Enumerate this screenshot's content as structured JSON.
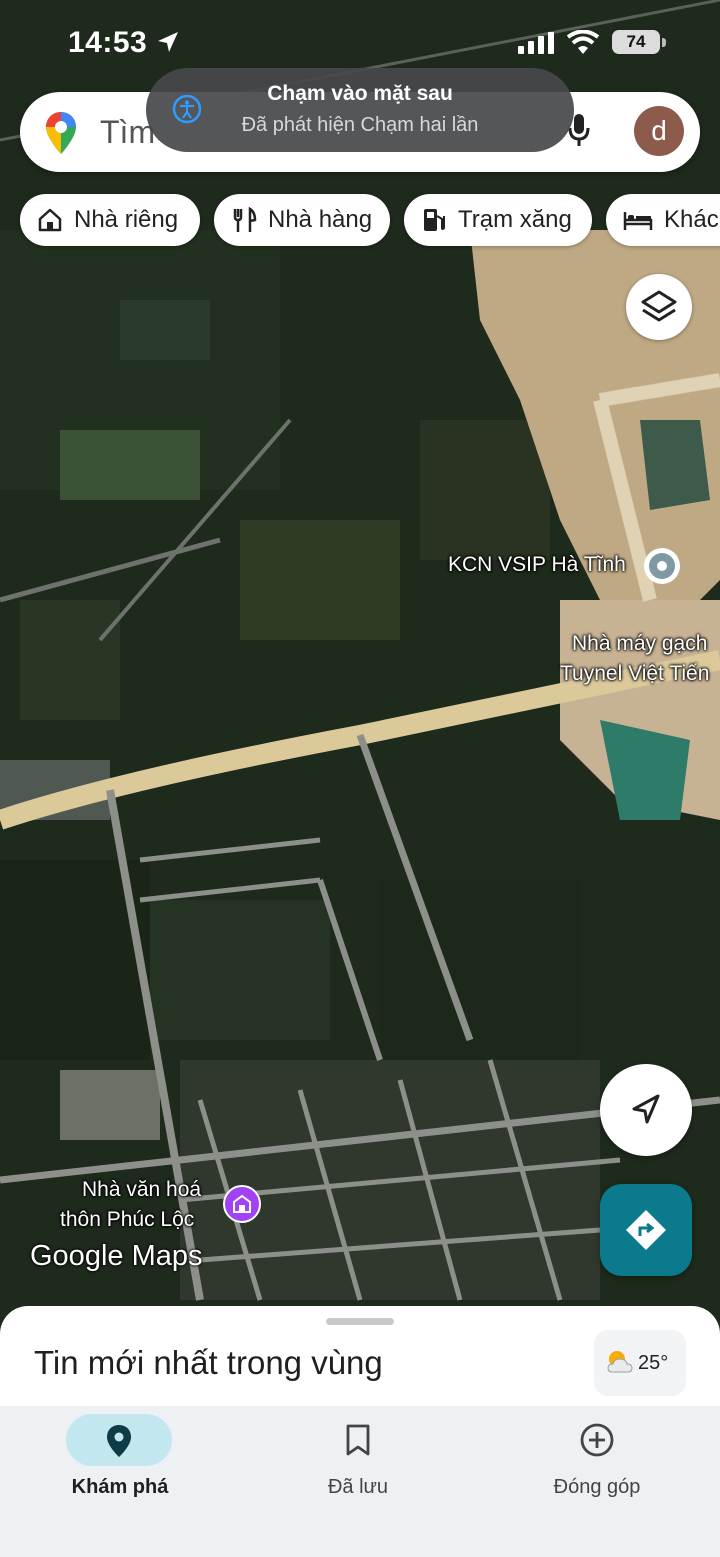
{
  "status_bar": {
    "time": "14:53",
    "battery": "74"
  },
  "search": {
    "placeholder": "Tìm",
    "avatar_initial": "d"
  },
  "toast": {
    "title": "Chạm vào mặt sau",
    "subtitle": "Đã phát hiện Chạm hai lần"
  },
  "chips": [
    {
      "label": "Nhà riêng",
      "icon": "home-icon"
    },
    {
      "label": "Nhà hàng",
      "icon": "restaurant-icon"
    },
    {
      "label": "Trạm xăng",
      "icon": "gas-station-icon"
    },
    {
      "label": "Khách",
      "icon": "hotel-icon"
    }
  ],
  "map_labels": {
    "kcn": "KCN VSIP Hà Tĩnh",
    "factory_line1": "Nhà máy gạch",
    "factory_line2": "Tuynel Việt Tiến",
    "culture_line1": "Nhà văn hoá",
    "culture_line2": "thôn Phúc Lộc"
  },
  "logo": "Google Maps",
  "sheet": {
    "title": "Tin mới nhất trong vùng",
    "temperature": "25°"
  },
  "bottom_nav": [
    {
      "label": "Khám phá",
      "icon": "explore-pin-icon",
      "active": true
    },
    {
      "label": "Đã lưu",
      "icon": "bookmark-icon",
      "active": false
    },
    {
      "label": "Đóng góp",
      "icon": "add-circle-icon",
      "active": false
    }
  ],
  "colors": {
    "accent": "#0b7a8c",
    "poi_purple": "#a142f4",
    "nav_pill": "#c2e7ef"
  }
}
